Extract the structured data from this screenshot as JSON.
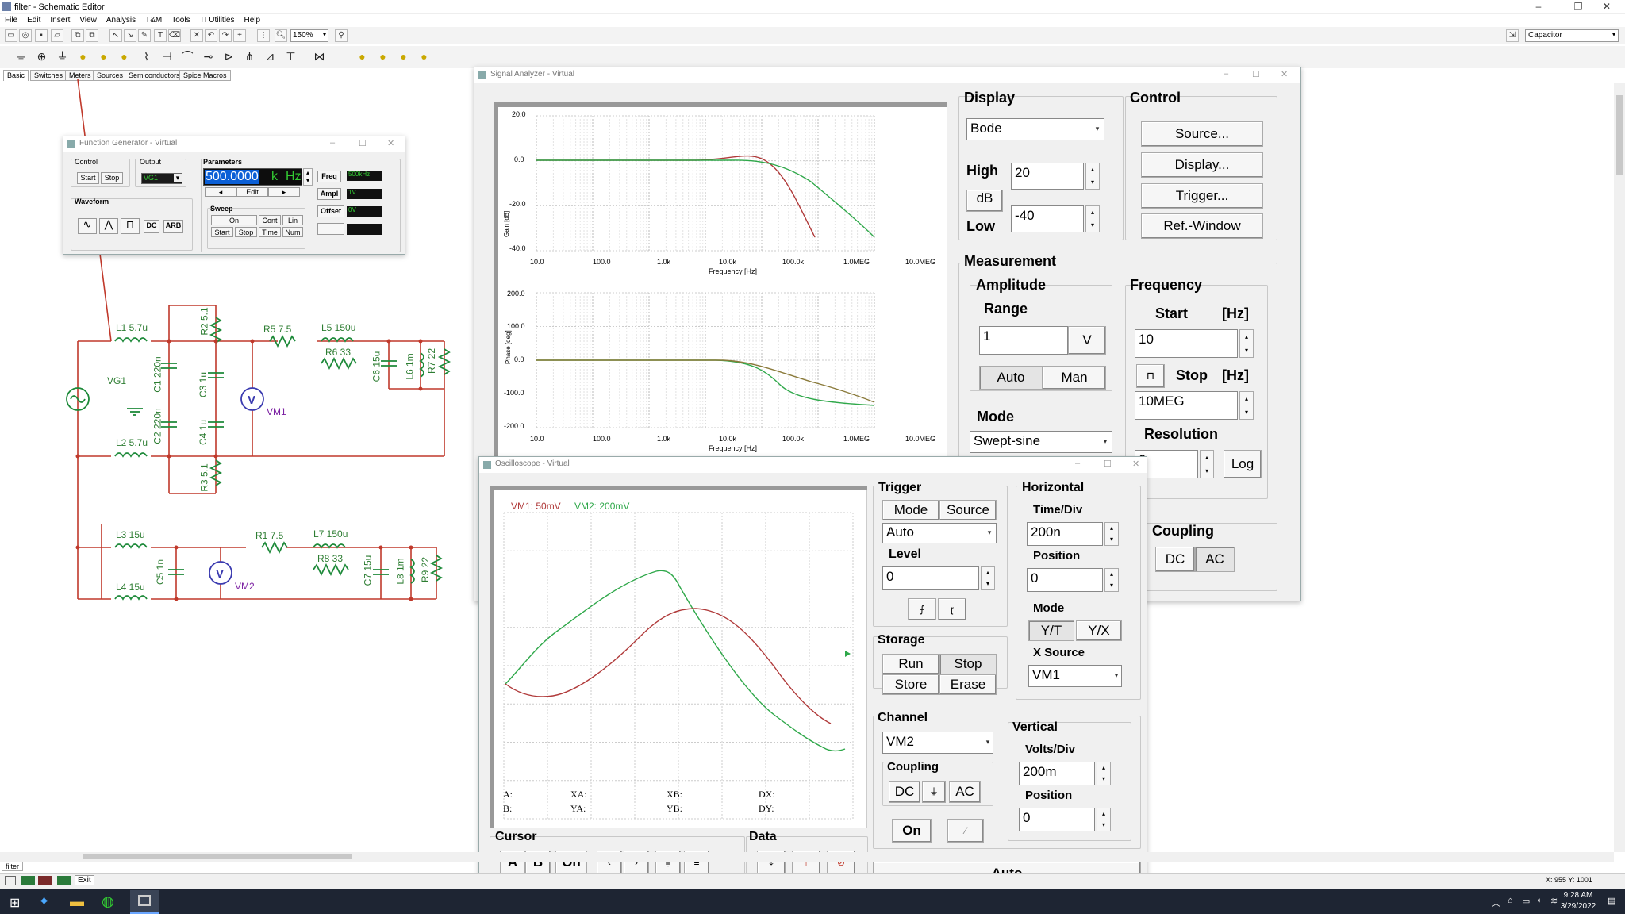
{
  "app": {
    "title": "filter - Schematic Editor"
  },
  "menu": [
    "File",
    "Edit",
    "Insert",
    "View",
    "Analysis",
    "T&M",
    "Tools",
    "TI Utilities",
    "Help"
  ],
  "toolbar": {
    "zoom": "150%",
    "component_select": "Capacitor"
  },
  "tabs": [
    "Basic",
    "Switches",
    "Meters",
    "Sources",
    "Semiconductors",
    "Spice Macros"
  ],
  "schematic": {
    "labels": {
      "L1": "L1 5.7u",
      "L2": "L2 5.7u",
      "R2": "R2 5.1",
      "R3": "R3 5.1",
      "C1": "C1 220n",
      "C2": "C2 220n",
      "C3": "C3 1u",
      "C4": "C4 1u",
      "VG1": "VG1",
      "VM1": "VM1",
      "R5": "R5 7.5",
      "L5": "L5 150u",
      "R6": "R6 33",
      "C6": "C6 15u",
      "L6": "L6 1m",
      "R7": "R7 22",
      "L3": "L3 15u",
      "L4": "L4 15u",
      "C5": "C5 1n",
      "VM2": "VM2",
      "R1": "R1 7.5",
      "L7": "L7 150u",
      "R8": "R8 33",
      "C7": "C7 15u",
      "L8": "L8 1m",
      "R9": "R9 22"
    }
  },
  "function_generator": {
    "title": "Function Generator - Virtual",
    "control_label": "Control",
    "start": "Start",
    "stop": "Stop",
    "output_label": "Output",
    "output_value": "VG1",
    "parameters_label": "Parameters",
    "value": "500.0000",
    "unit_prefix": "k",
    "unit": "Hz",
    "edit": "Edit",
    "prev": "◂",
    "next": "▸",
    "freq_label": "Freq",
    "freq_value": "500kHz",
    "ampl_label": "Ampl",
    "ampl_value": "1V",
    "offset_label": "Offset",
    "offset_value": "0V",
    "waveform_label": "Waveform",
    "dc": "DC",
    "arb": "ARB",
    "sweep_label": "Sweep",
    "on": "On",
    "cont": "Cont",
    "lin": "Lin",
    "sstart": "Start",
    "sstop": "Stop",
    "time": "Time",
    "num": "Num"
  },
  "signal_analyzer": {
    "title": "Signal Analyzer - Virtual",
    "display_label": "Display",
    "display_mode": "Bode",
    "high_label": "High",
    "high_value": "20",
    "db": "dB",
    "low_label": "Low",
    "low_value": "-40",
    "control_label": "Control",
    "source_btn": "Source...",
    "display_btn": "Display...",
    "trigger_btn": "Trigger...",
    "refwindow_btn": "Ref.-Window",
    "measurement_label": "Measurement",
    "amplitude_label": "Amplitude",
    "range_label": "Range",
    "range_value": "1",
    "v_btn": "V",
    "auto_btn": "Auto",
    "man_btn": "Man",
    "frequency_label": "Frequency",
    "start_label": "Start",
    "hz1": "[Hz]",
    "start_value": "10",
    "stop_label": "Stop",
    "hz2": "[Hz]",
    "stop_value": "10MEG",
    "sym": "⊓",
    "mode_label": "Mode",
    "mode_value": "Swept-sine",
    "resolution_label": "Resolution",
    "resolution_value": "0",
    "log_btn": "Log",
    "coupling_label": "Coupling",
    "dc_btn": "DC",
    "ac_btn": "AC",
    "gain_ylabel": "Gain [dB]",
    "phase_ylabel": "Phase [deg]",
    "xlabel": "Frequency [Hz]",
    "gain_ticks": [
      "20.0",
      "0.0",
      "-20.0",
      "-40.0"
    ],
    "phase_ticks": [
      "200.0",
      "100.0",
      "0.0",
      "-100.0",
      "-200.0"
    ],
    "x_ticks": [
      "10.0",
      "100.0",
      "1.0k",
      "10.0k",
      "100.0k",
      "1.0MEG",
      "10.0MEG"
    ]
  },
  "oscilloscope": {
    "title": "Oscilloscope - Virtual",
    "ch_label1": "VM1: 50mV",
    "ch_label2": "VM2: 200mV",
    "a": "A:",
    "b": "B:",
    "xa": "XA:",
    "ya": "YA:",
    "xb": "XB:",
    "yb": "YB:",
    "dx": "DX:",
    "dy": "DY:",
    "trigger_label": "Trigger",
    "mode_btn": "Mode",
    "source_btn": "Source",
    "trig_mode": "Auto",
    "level_label": "Level",
    "level_value": "0",
    "fall": "⨍",
    "rise": "ɽ",
    "horizontal_label": "Horizontal",
    "timediv_label": "Time/Div",
    "timediv_value": "200n",
    "hpos_label": "Position",
    "hpos_value": "0",
    "hmode_label": "Mode",
    "yt": "Y/T",
    "yx": "Y/X",
    "xsource_label": "X Source",
    "xsource_value": "VM1",
    "storage_label": "Storage",
    "run": "Run",
    "stop": "Stop",
    "store": "Store",
    "erase": "Erase",
    "channel_label": "Channel",
    "channel_value": "VM2",
    "coupling_label": "Coupling",
    "dc": "DC",
    "gnd": "⏚",
    "ac": "AC",
    "on": "On",
    "vertical_label": "Vertical",
    "voltsdiv_label": "Volts/Div",
    "voltsdiv_value": "200m",
    "vpos_label": "Position",
    "vpos_value": "0",
    "cursor_label": "Cursor",
    "ca": "A",
    "cb": "B",
    "con": "On",
    "data_label": "Data",
    "auto_btn": "Auto"
  },
  "status": {
    "tab": "filter",
    "exit": "Exit",
    "coords": "X: 955  Y: 1001"
  },
  "taskbar": {
    "time": "9:28 AM",
    "date": "3/29/2022"
  },
  "colors": {
    "wire": "#c0392b",
    "part": "#1e8a3a",
    "red_trace": "#b03a3a",
    "green_trace": "#2fa84a",
    "label": "#2d7d32",
    "meter": "#7b1fa2"
  }
}
